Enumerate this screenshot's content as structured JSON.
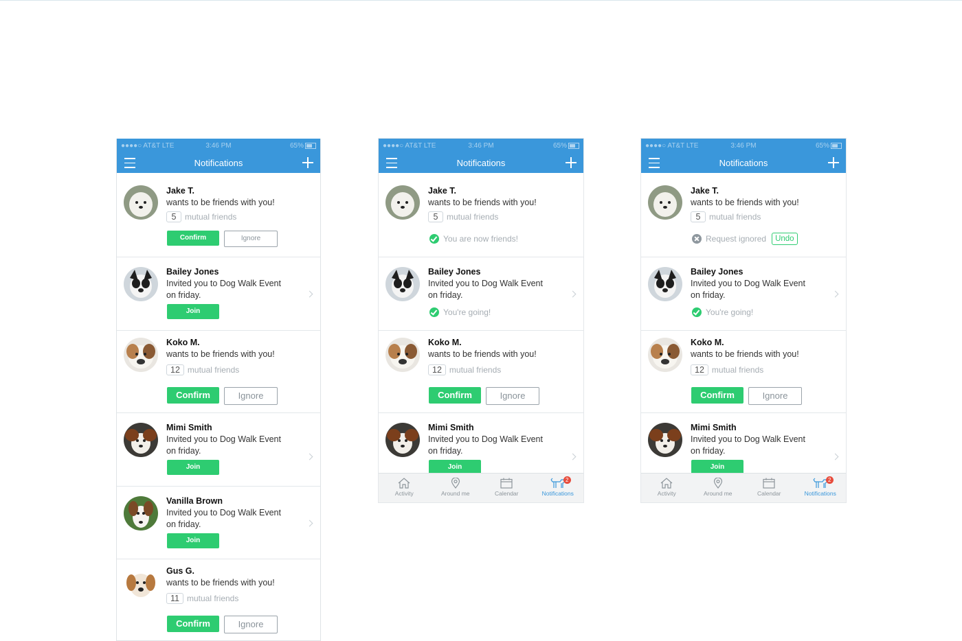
{
  "status": {
    "carrier": "●●●●○ AT&T  LTE",
    "time": "3:46 PM",
    "battery": "65%"
  },
  "nav": {
    "title": "Notifications"
  },
  "common": {
    "friend_msg": "wants to be friends with you!",
    "event_msg_1": "Invited you to Dog Walk Event",
    "event_msg_2": "on friday.",
    "mutual_label": "mutual friends",
    "confirm": "Confirm",
    "ignore": "Ignore",
    "join": "Join",
    "now_friends": "You are now friends!",
    "going": "You're going!",
    "request_ignored": "Request ignored",
    "undo": "Undo"
  },
  "people": {
    "jake": {
      "name": "Jake T.",
      "mutual": "5"
    },
    "bailey": {
      "name": "Bailey Jones"
    },
    "koko": {
      "name": "Koko M.",
      "mutual": "12"
    },
    "mimi": {
      "name": "Mimi Smith"
    },
    "vanilla": {
      "name": "Vanilla Brown"
    },
    "gus": {
      "name": "Gus G.",
      "mutual": "11"
    }
  },
  "tabs": [
    {
      "label": "Activity",
      "icon": "home-icon"
    },
    {
      "label": "Around me",
      "icon": "map-pin-icon"
    },
    {
      "label": "Calendar",
      "icon": "calendar-icon"
    },
    {
      "label": "Notifications",
      "icon": "dog-icon",
      "badge": "2"
    }
  ],
  "colors": {
    "header": "#3a97db",
    "accent": "#2ecc71",
    "badge": "#e74c3c"
  }
}
